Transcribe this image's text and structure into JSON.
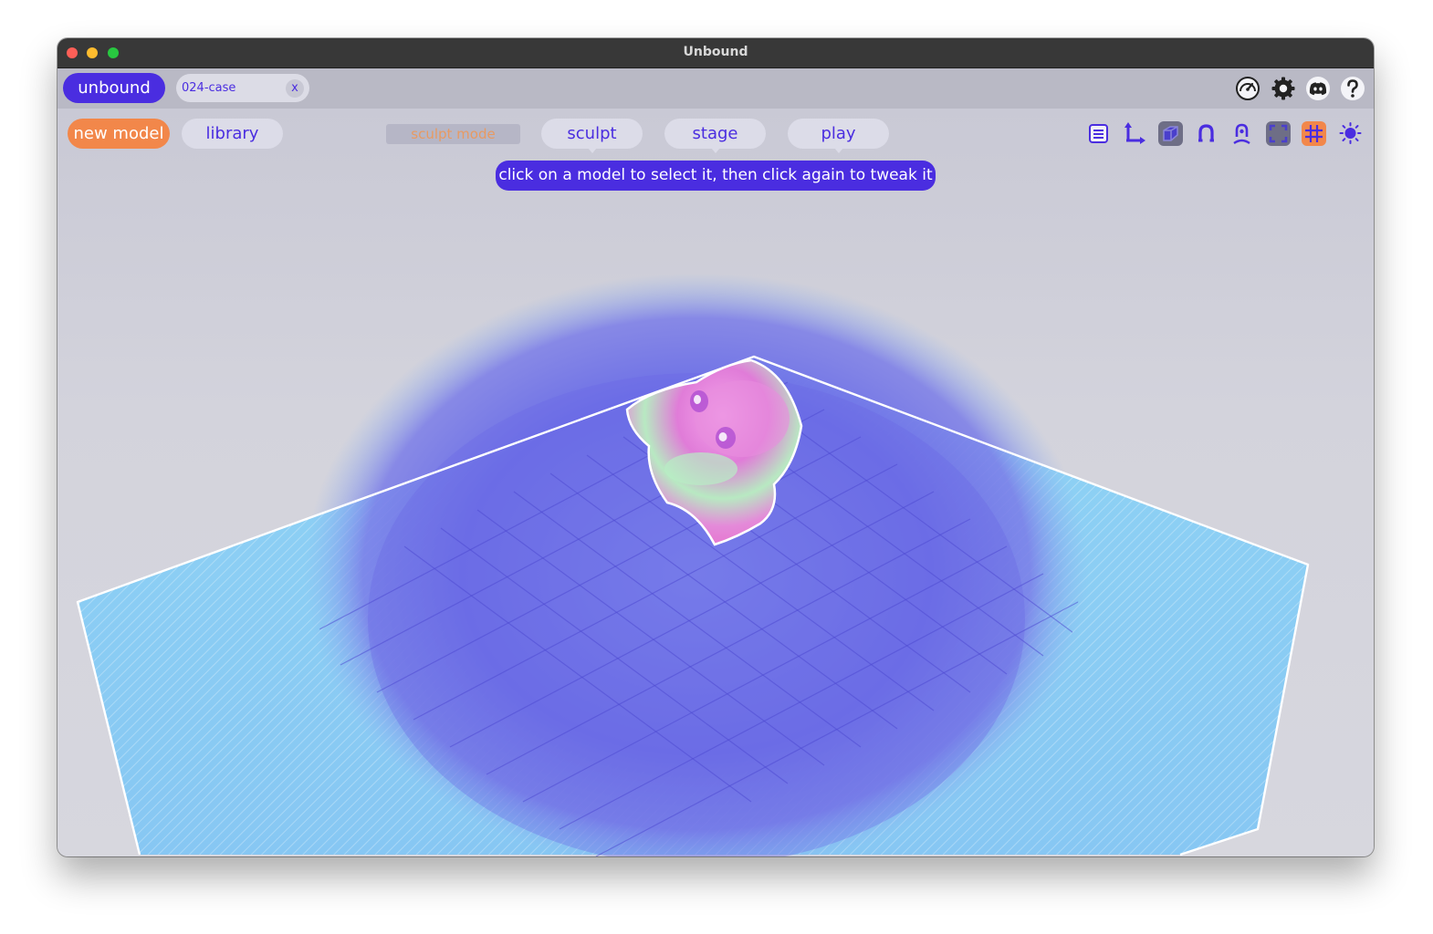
{
  "window": {
    "title": "Unbound"
  },
  "tabbar": {
    "app_label": "unbound",
    "file_tab": {
      "label": "024-case",
      "close_label": "x"
    },
    "icons": [
      "speedometer-icon",
      "settings-icon",
      "discord-icon",
      "help-icon"
    ]
  },
  "toolbar": {
    "new_model_label": "new model",
    "library_label": "library",
    "mode_indicator": "sculpt mode",
    "modes": [
      {
        "label": "sculpt"
      },
      {
        "label": "stage"
      },
      {
        "label": "play"
      }
    ],
    "tools": [
      "list-icon",
      "axis-icon",
      "cube-icon",
      "magnet-icon",
      "person-icon",
      "fullscreen-icon",
      "grid-icon",
      "light-icon"
    ],
    "active_tool": "grid-icon"
  },
  "hint": {
    "text": "click on a model to select it, then click again to tweak it"
  },
  "colors": {
    "accent": "#4a2de0",
    "highlight": "#f2874a",
    "titlebar": "#383838",
    "tabbar": "#b9b9c5",
    "canvas": "#cfcfd9",
    "stage_cyan": "#8fd6f2",
    "stage_purple": "#6a66e6",
    "model_pink": "#e07cd8",
    "model_green": "#a9ecb0"
  }
}
